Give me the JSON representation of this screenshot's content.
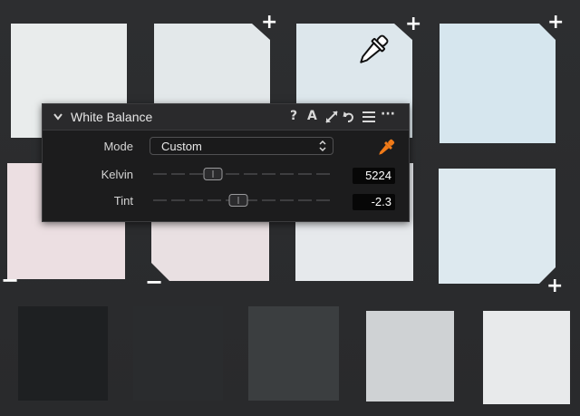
{
  "panel": {
    "title": "White Balance",
    "header_icons": [
      "chevron-down-icon",
      "help-icon",
      "auto-icon",
      "copy-apply-icon",
      "reset-icon",
      "presets-menu-icon",
      "more-icon"
    ],
    "help_label": "?",
    "auto_label": "A",
    "more_label": "···",
    "mode": {
      "label": "Mode",
      "value": "Custom"
    },
    "kelvin": {
      "label": "Kelvin",
      "value": "5224",
      "slider_fraction": 0.34
    },
    "tint": {
      "label": "Tint",
      "value": "-2.3",
      "slider_fraction": 0.48
    },
    "picker_icon": "eyedropper-icon",
    "picker_color": "#f07a18"
  },
  "canvas": {
    "cursor_icon": "eyedropper-cursor-icon",
    "markers": {
      "plus": "+",
      "minus": "−"
    }
  }
}
